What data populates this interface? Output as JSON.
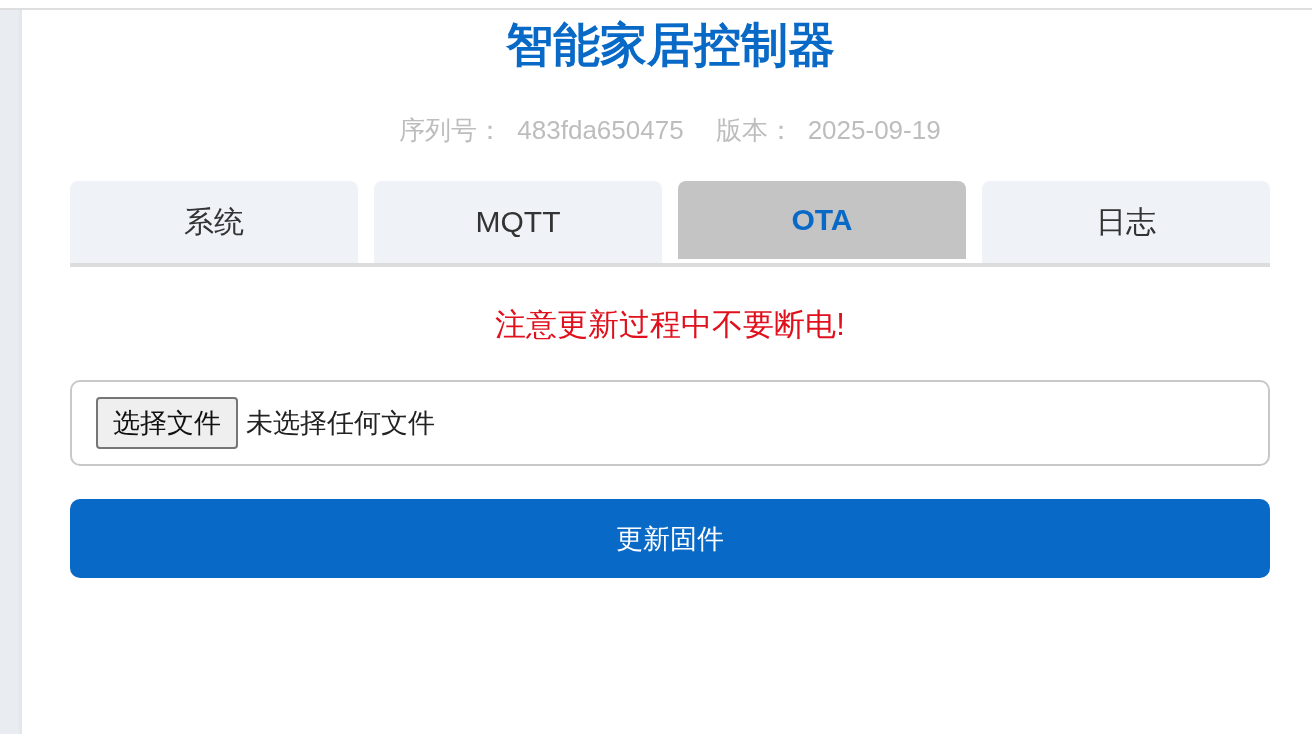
{
  "header": {
    "title": "智能家居控制器",
    "info": [
      {
        "label": "序列号：",
        "value": "483fda650475"
      },
      {
        "label": "版本：",
        "value": "2025-09-19"
      }
    ]
  },
  "tabs": [
    {
      "label": "系统",
      "selected": false
    },
    {
      "label": "MQTT",
      "selected": false
    },
    {
      "label": "OTA",
      "selected": true
    },
    {
      "label": "日志",
      "selected": false
    }
  ],
  "ota": {
    "warning": "注意更新过程中不要断电!",
    "file_input": {
      "button": "选择文件",
      "status": "未选择任何文件"
    },
    "submit": "更新固件"
  }
}
